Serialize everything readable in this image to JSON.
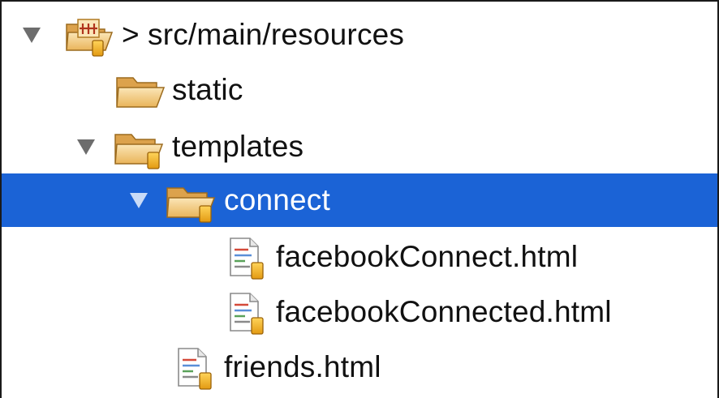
{
  "tree": {
    "root": {
      "separator": ">",
      "label": "src/main/resources",
      "icon": "source-folder-package-icon"
    },
    "items": [
      {
        "label": "static",
        "icon": "folder-icon",
        "expanded": false,
        "selected": false
      },
      {
        "label": "templates",
        "icon": "folder-resource-icon",
        "expanded": true,
        "selected": false
      },
      {
        "label": "connect",
        "icon": "folder-resource-icon",
        "expanded": true,
        "selected": true
      },
      {
        "label": "facebookConnect.html",
        "icon": "html-file-icon",
        "selected": false
      },
      {
        "label": "facebookConnected.html",
        "icon": "html-file-icon",
        "selected": false
      },
      {
        "label": "friends.html",
        "icon": "html-file-icon",
        "selected": false
      }
    ]
  },
  "colors": {
    "selection": "#1b63d6",
    "folder": "#f2c36a",
    "badge": "#f0a81a",
    "text": "#111111"
  }
}
